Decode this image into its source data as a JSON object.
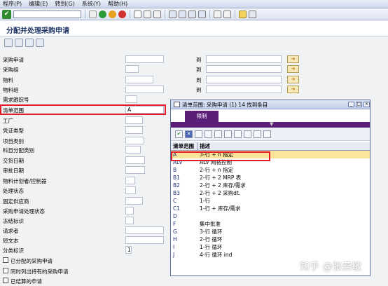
{
  "menubar": [
    "程序(P)",
    "编辑(E)",
    "转到(G)",
    "系统(Y)",
    "帮助(H)"
  ],
  "page_title": "分配并处理采购申请",
  "to_label": "到",
  "rows": [
    {
      "label": "采购申请",
      "value": "",
      "range": true
    },
    {
      "label": "采购组",
      "value": "",
      "range": true
    },
    {
      "label": "物料",
      "value": "",
      "range": true
    },
    {
      "label": "物料组",
      "value": "",
      "range": true
    },
    {
      "label": "需求跟踪号",
      "value": "",
      "range": false
    },
    {
      "label": "清单范围",
      "value": "A",
      "range": false
    },
    {
      "label": "工厂",
      "value": "",
      "range": false
    },
    {
      "label": "凭证类型",
      "value": "",
      "range": false
    },
    {
      "label": "项目类别",
      "value": "",
      "range": false
    },
    {
      "label": "科目分配类别",
      "value": "",
      "range": false
    },
    {
      "label": "交货日期",
      "value": "",
      "range": false
    },
    {
      "label": "审批日期",
      "value": "",
      "range": false
    },
    {
      "label": "物料计划者/控制器",
      "value": "",
      "range": false
    },
    {
      "label": "处理状态",
      "value": "",
      "range": false
    },
    {
      "label": "固定供应商",
      "value": "",
      "range": false
    },
    {
      "label": "采购申请处理状态",
      "value": "",
      "range": false
    },
    {
      "label": "冻结标识",
      "value": "",
      "range": false
    },
    {
      "label": "请求者",
      "value": "",
      "range": false
    },
    {
      "label": "短文本",
      "value": "",
      "range": false
    },
    {
      "label": "分类标识",
      "value": "1",
      "range": false
    }
  ],
  "checkboxes": [
    "已分配的采购申请",
    "同时列出持有的采购申请",
    "已结算的申请"
  ],
  "popup": {
    "title": "清单范围: 采购申请 (1)   14 找到条目",
    "tab": "限制",
    "col_key": "清单范围",
    "col_desc": "描述",
    "entries": [
      {
        "key": "A",
        "desc": "3-行 + n 指定"
      },
      {
        "key": "ALV",
        "desc": "ALV 网格控制"
      },
      {
        "key": "B",
        "desc": "2-行 + n 指定"
      },
      {
        "key": "B1",
        "desc": "2-行 + 2 MRP 表"
      },
      {
        "key": "B2",
        "desc": "2-行 + 2 库存/需求"
      },
      {
        "key": "B3",
        "desc": "2-行 + 2 采购dt."
      },
      {
        "key": "C",
        "desc": "1-行"
      },
      {
        "key": "C1",
        "desc": "1-行 + 库存/需求"
      },
      {
        "key": "D",
        "desc": ""
      },
      {
        "key": "F",
        "desc": "集中批准"
      },
      {
        "key": "G",
        "desc": "3-行 循环"
      },
      {
        "key": "H",
        "desc": "2-行 循环"
      },
      {
        "key": "I",
        "desc": "1-行 循环"
      },
      {
        "key": "J",
        "desc": "4-行 循环 ind"
      }
    ]
  },
  "watermark": "知乎 @张燕敏",
  "colors": {
    "popup_accent": "#5b1f7a",
    "highlight": "#e41a2b",
    "selected_row": "#fbe59a"
  }
}
